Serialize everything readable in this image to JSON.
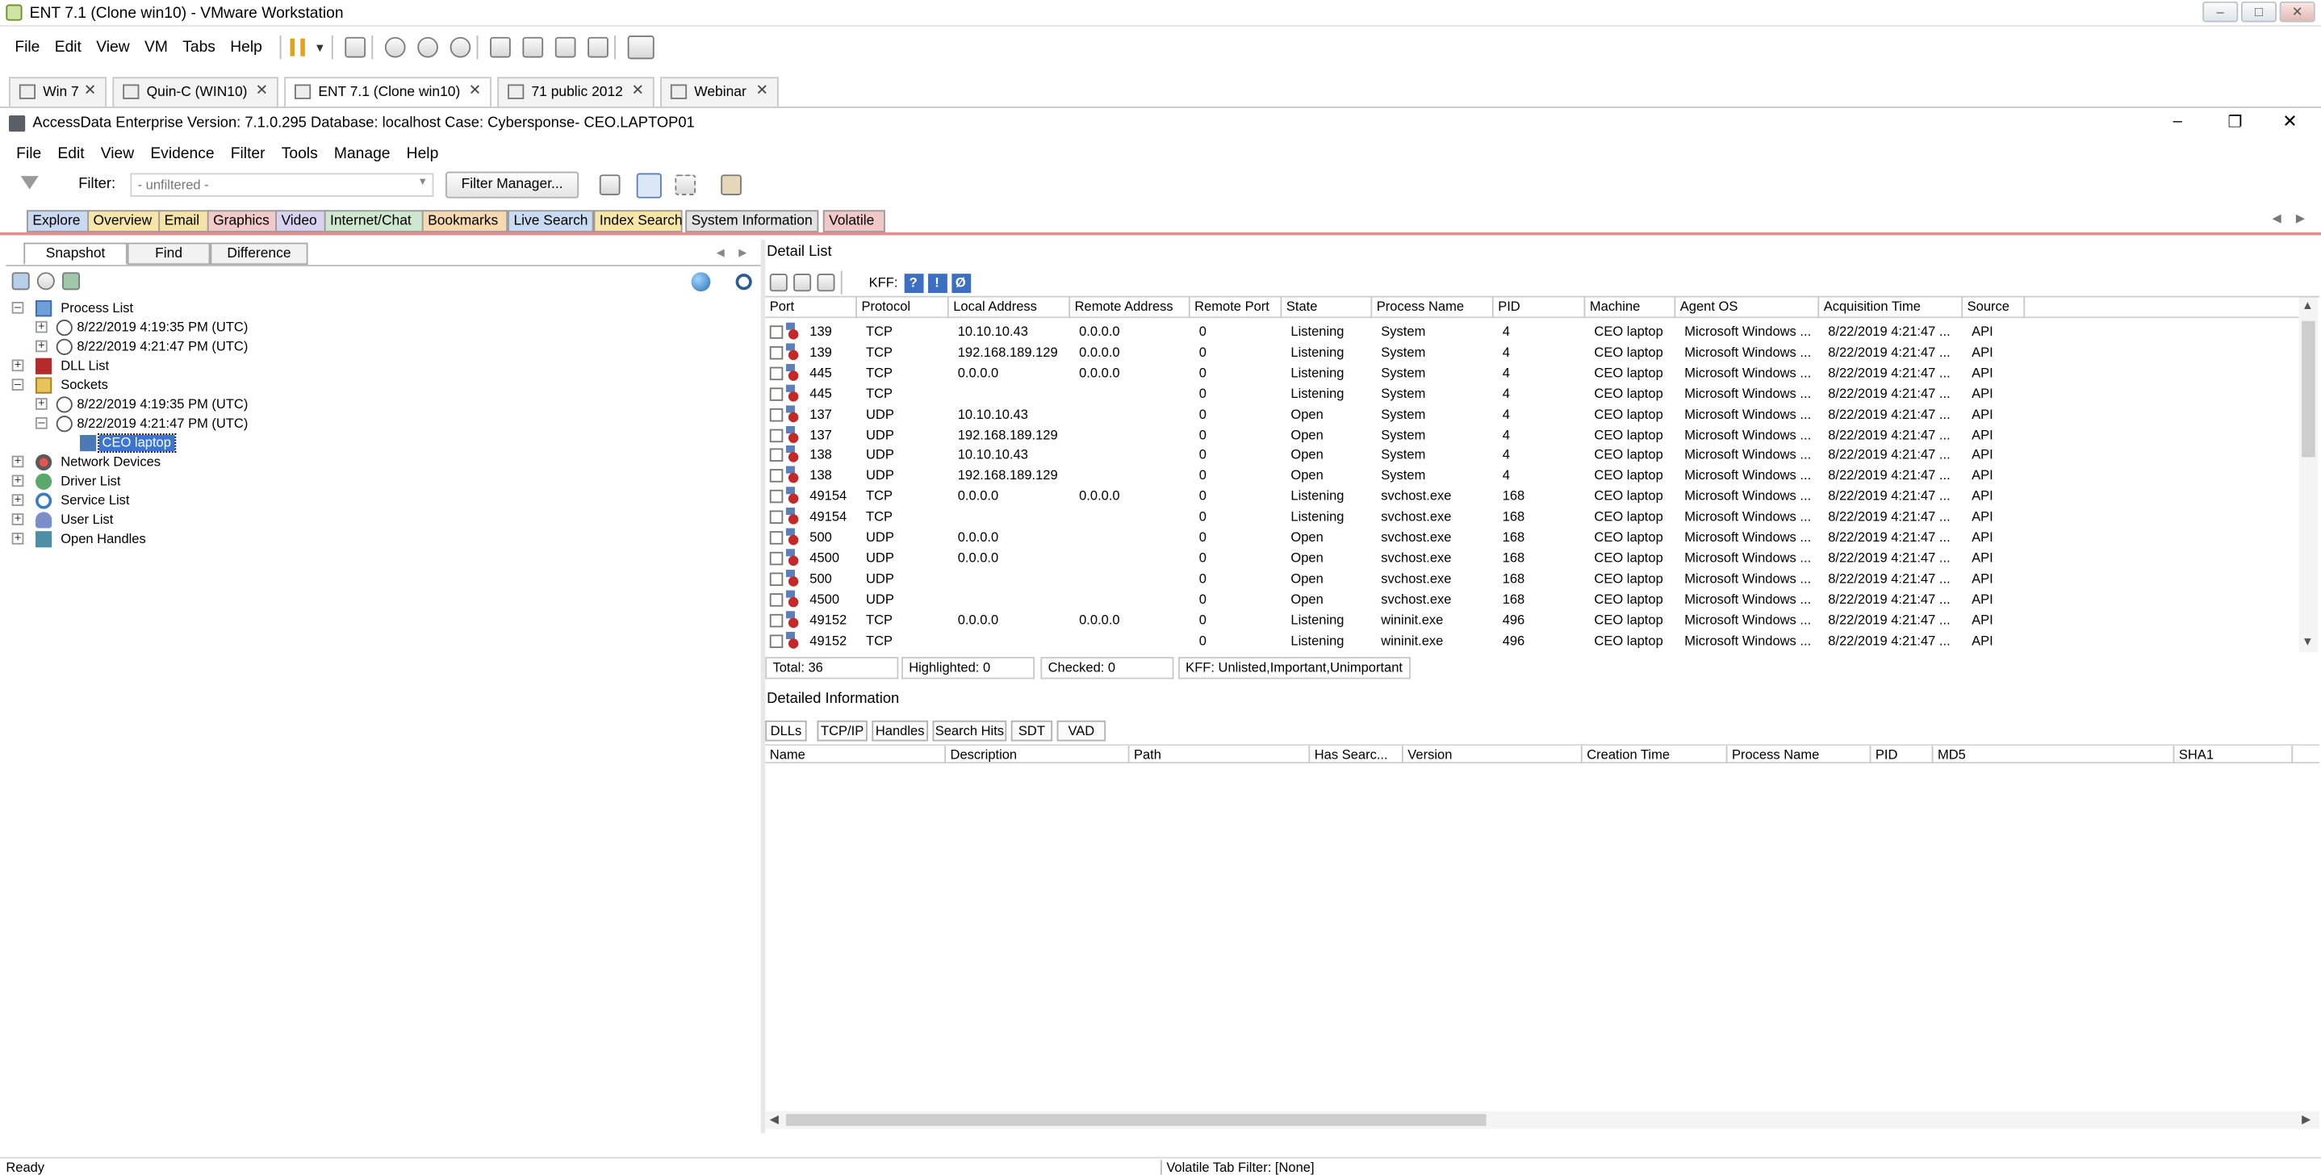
{
  "vmware": {
    "title": "ENT 7.1 (Clone win10) - VMware Workstation",
    "menu": [
      "File",
      "Edit",
      "View",
      "VM",
      "Tabs",
      "Help"
    ],
    "tabs": [
      {
        "label": "Win 7"
      },
      {
        "label": "Quin-C (WIN10)"
      },
      {
        "label": "ENT 7.1 (Clone win10)",
        "active": true
      },
      {
        "label": "71 public 2012"
      },
      {
        "label": "Webinar"
      }
    ]
  },
  "app": {
    "title": "AccessData Enterprise Version: 7.1.0.295 Database: localhost Case: Cybersponse- CEO.LAPTOP01",
    "menu": [
      "File",
      "Edit",
      "View",
      "Evidence",
      "Filter",
      "Tools",
      "Manage",
      "Help"
    ],
    "filter_label": "Filter:",
    "filter_value": "- unfiltered -",
    "filter_manager_label": "Filter Manager...",
    "main_tabs": [
      {
        "label": "Explore",
        "color": "#c9d9f2"
      },
      {
        "label": "Overview",
        "color": "#f7e5a8"
      },
      {
        "label": "Email",
        "color": "#f5e2a6"
      },
      {
        "label": "Graphics",
        "color": "#f2c9c9"
      },
      {
        "label": "Video",
        "color": "#d9d2ef"
      },
      {
        "label": "Internet/Chat",
        "color": "#cfe7cf"
      },
      {
        "label": "Bookmarks",
        "color": "#f6d9b0"
      },
      {
        "label": "Live Search",
        "color": "#c9dbf2"
      },
      {
        "label": "Index Search",
        "color": "#f7e6a6"
      },
      {
        "label": "System Information",
        "color": "#e3e3e3"
      },
      {
        "label": "Volatile",
        "color": "#f1c8c8"
      }
    ]
  },
  "left": {
    "tabs": [
      "Snapshot",
      "Find",
      "Difference"
    ],
    "tree": {
      "process_list": "Process List",
      "process_snapshot_1": "8/22/2019 4:19:35 PM (UTC)",
      "process_snapshot_2": "8/22/2019 4:21:47 PM (UTC)",
      "dll_list": "DLL List",
      "sockets": "Sockets",
      "socket_snapshot_1": "8/22/2019 4:19:35 PM (UTC)",
      "socket_snapshot_2": "8/22/2019 4:21:47 PM (UTC)",
      "socket_machine": "CEO laptop",
      "network_devices": "Network Devices",
      "driver_list": "Driver List",
      "service_list": "Service List",
      "user_list": "User List",
      "open_handles": "Open Handles"
    }
  },
  "detail": {
    "title": "Detail List",
    "kff_label": "KFF:",
    "columns": [
      "Port",
      "Protocol",
      "Local Address",
      "Remote Address",
      "Remote Port",
      "State",
      "Process Name",
      "PID",
      "Machine",
      "Agent OS",
      "Acquisition Time",
      "Source"
    ],
    "rows": [
      [
        "139",
        "TCP",
        "10.10.10.43",
        "0.0.0.0",
        "0",
        "Listening",
        "System",
        "4",
        "CEO laptop",
        "Microsoft Windows ...",
        "8/22/2019 4:21:47 ...",
        "API"
      ],
      [
        "139",
        "TCP",
        "192.168.189.129",
        "0.0.0.0",
        "0",
        "Listening",
        "System",
        "4",
        "CEO laptop",
        "Microsoft Windows ...",
        "8/22/2019 4:21:47 ...",
        "API"
      ],
      [
        "445",
        "TCP",
        "0.0.0.0",
        "0.0.0.0",
        "0",
        "Listening",
        "System",
        "4",
        "CEO laptop",
        "Microsoft Windows ...",
        "8/22/2019 4:21:47 ...",
        "API"
      ],
      [
        "445",
        "TCP",
        "",
        "",
        "0",
        "Listening",
        "System",
        "4",
        "CEO laptop",
        "Microsoft Windows ...",
        "8/22/2019 4:21:47 ...",
        "API"
      ],
      [
        "137",
        "UDP",
        "10.10.10.43",
        "",
        "0",
        "Open",
        "System",
        "4",
        "CEO laptop",
        "Microsoft Windows ...",
        "8/22/2019 4:21:47 ...",
        "API"
      ],
      [
        "137",
        "UDP",
        "192.168.189.129",
        "",
        "0",
        "Open",
        "System",
        "4",
        "CEO laptop",
        "Microsoft Windows ...",
        "8/22/2019 4:21:47 ...",
        "API"
      ],
      [
        "138",
        "UDP",
        "10.10.10.43",
        "",
        "0",
        "Open",
        "System",
        "4",
        "CEO laptop",
        "Microsoft Windows ...",
        "8/22/2019 4:21:47 ...",
        "API"
      ],
      [
        "138",
        "UDP",
        "192.168.189.129",
        "",
        "0",
        "Open",
        "System",
        "4",
        "CEO laptop",
        "Microsoft Windows ...",
        "8/22/2019 4:21:47 ...",
        "API"
      ],
      [
        "49154",
        "TCP",
        "0.0.0.0",
        "0.0.0.0",
        "0",
        "Listening",
        "svchost.exe",
        "168",
        "CEO laptop",
        "Microsoft Windows ...",
        "8/22/2019 4:21:47 ...",
        "API"
      ],
      [
        "49154",
        "TCP",
        "",
        "",
        "0",
        "Listening",
        "svchost.exe",
        "168",
        "CEO laptop",
        "Microsoft Windows ...",
        "8/22/2019 4:21:47 ...",
        "API"
      ],
      [
        "500",
        "UDP",
        "0.0.0.0",
        "",
        "0",
        "Open",
        "svchost.exe",
        "168",
        "CEO laptop",
        "Microsoft Windows ...",
        "8/22/2019 4:21:47 ...",
        "API"
      ],
      [
        "4500",
        "UDP",
        "0.0.0.0",
        "",
        "0",
        "Open",
        "svchost.exe",
        "168",
        "CEO laptop",
        "Microsoft Windows ...",
        "8/22/2019 4:21:47 ...",
        "API"
      ],
      [
        "500",
        "UDP",
        "",
        "",
        "0",
        "Open",
        "svchost.exe",
        "168",
        "CEO laptop",
        "Microsoft Windows ...",
        "8/22/2019 4:21:47 ...",
        "API"
      ],
      [
        "4500",
        "UDP",
        "",
        "",
        "0",
        "Open",
        "svchost.exe",
        "168",
        "CEO laptop",
        "Microsoft Windows ...",
        "8/22/2019 4:21:47 ...",
        "API"
      ],
      [
        "49152",
        "TCP",
        "0.0.0.0",
        "0.0.0.0",
        "0",
        "Listening",
        "wininit.exe",
        "496",
        "CEO laptop",
        "Microsoft Windows ...",
        "8/22/2019 4:21:47 ...",
        "API"
      ],
      [
        "49152",
        "TCP",
        "",
        "",
        "0",
        "Listening",
        "wininit.exe",
        "496",
        "CEO laptop",
        "Microsoft Windows ...",
        "8/22/2019 4:21:47 ...",
        "API"
      ]
    ],
    "status": {
      "total": "Total: 36",
      "highlighted": "Highlighted: 0",
      "checked": "Checked: 0",
      "kff": "KFF: Unlisted,Important,Unimportant"
    }
  },
  "detailed_info": {
    "title": "Detailed Information",
    "tabs": [
      "DLLs",
      "TCP/IP",
      "Handles",
      "Search Hits",
      "SDT",
      "VAD"
    ],
    "columns": [
      "Name",
      "Description",
      "Path",
      "Has Searc...",
      "Version",
      "Creation Time",
      "Process Name",
      "PID",
      "MD5",
      "SHA1"
    ]
  },
  "statusbar": {
    "left": "Ready",
    "center": "Volatile Tab Filter: [None]"
  }
}
